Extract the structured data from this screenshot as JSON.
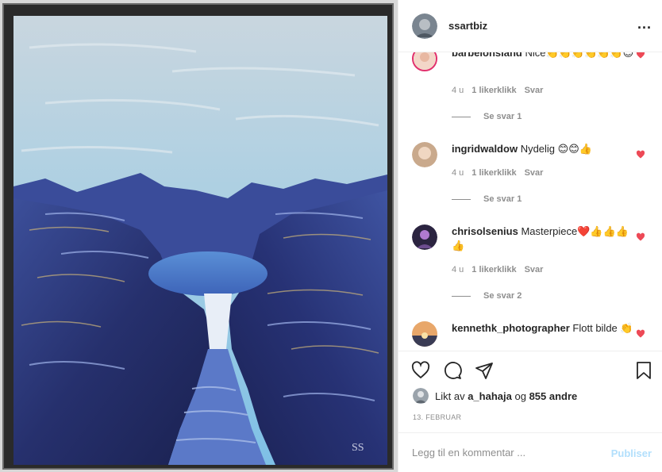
{
  "post": {
    "username": "ssartbiz",
    "more_label": "...",
    "signature": "SS"
  },
  "comments": [
    {
      "username": "barbelonsland",
      "text": "Nice👏👏👏👏👏👏😊",
      "time": "4 u",
      "likes": "1 likerklikk",
      "reply": "Svar",
      "see_replies": "Se svar 1"
    },
    {
      "username": "ingridwaldow",
      "text": "Nydelig 😊😊👍",
      "time": "4 u",
      "likes": "1 likerklikk",
      "reply": "Svar",
      "see_replies": "Se svar 1"
    },
    {
      "username": "chrisolsenius",
      "text": "Masterpiece❤️👍👍👍👍",
      "time": "4 u",
      "likes": "1 likerklikk",
      "reply": "Svar",
      "see_replies": "Se svar 2"
    },
    {
      "username": "kennethk_photographer",
      "text": "Flott bilde 👏"
    }
  ],
  "likes": {
    "prefix": "Likt av",
    "user": "a_hahaja",
    "middle": "og",
    "count": "855 andre"
  },
  "date": "13. FEBRUAR",
  "add_comment": {
    "placeholder": "Legg til en kommentar ...",
    "post_label": "Publiser"
  },
  "colors": {
    "heart": "#ed4956",
    "muted": "#8e8e8e",
    "publish_disabled": "#b2dffc"
  },
  "icons": [
    "heart-outline-icon",
    "comment-icon",
    "share-icon",
    "bookmark-icon",
    "more-icon",
    "like-heart-icon"
  ]
}
